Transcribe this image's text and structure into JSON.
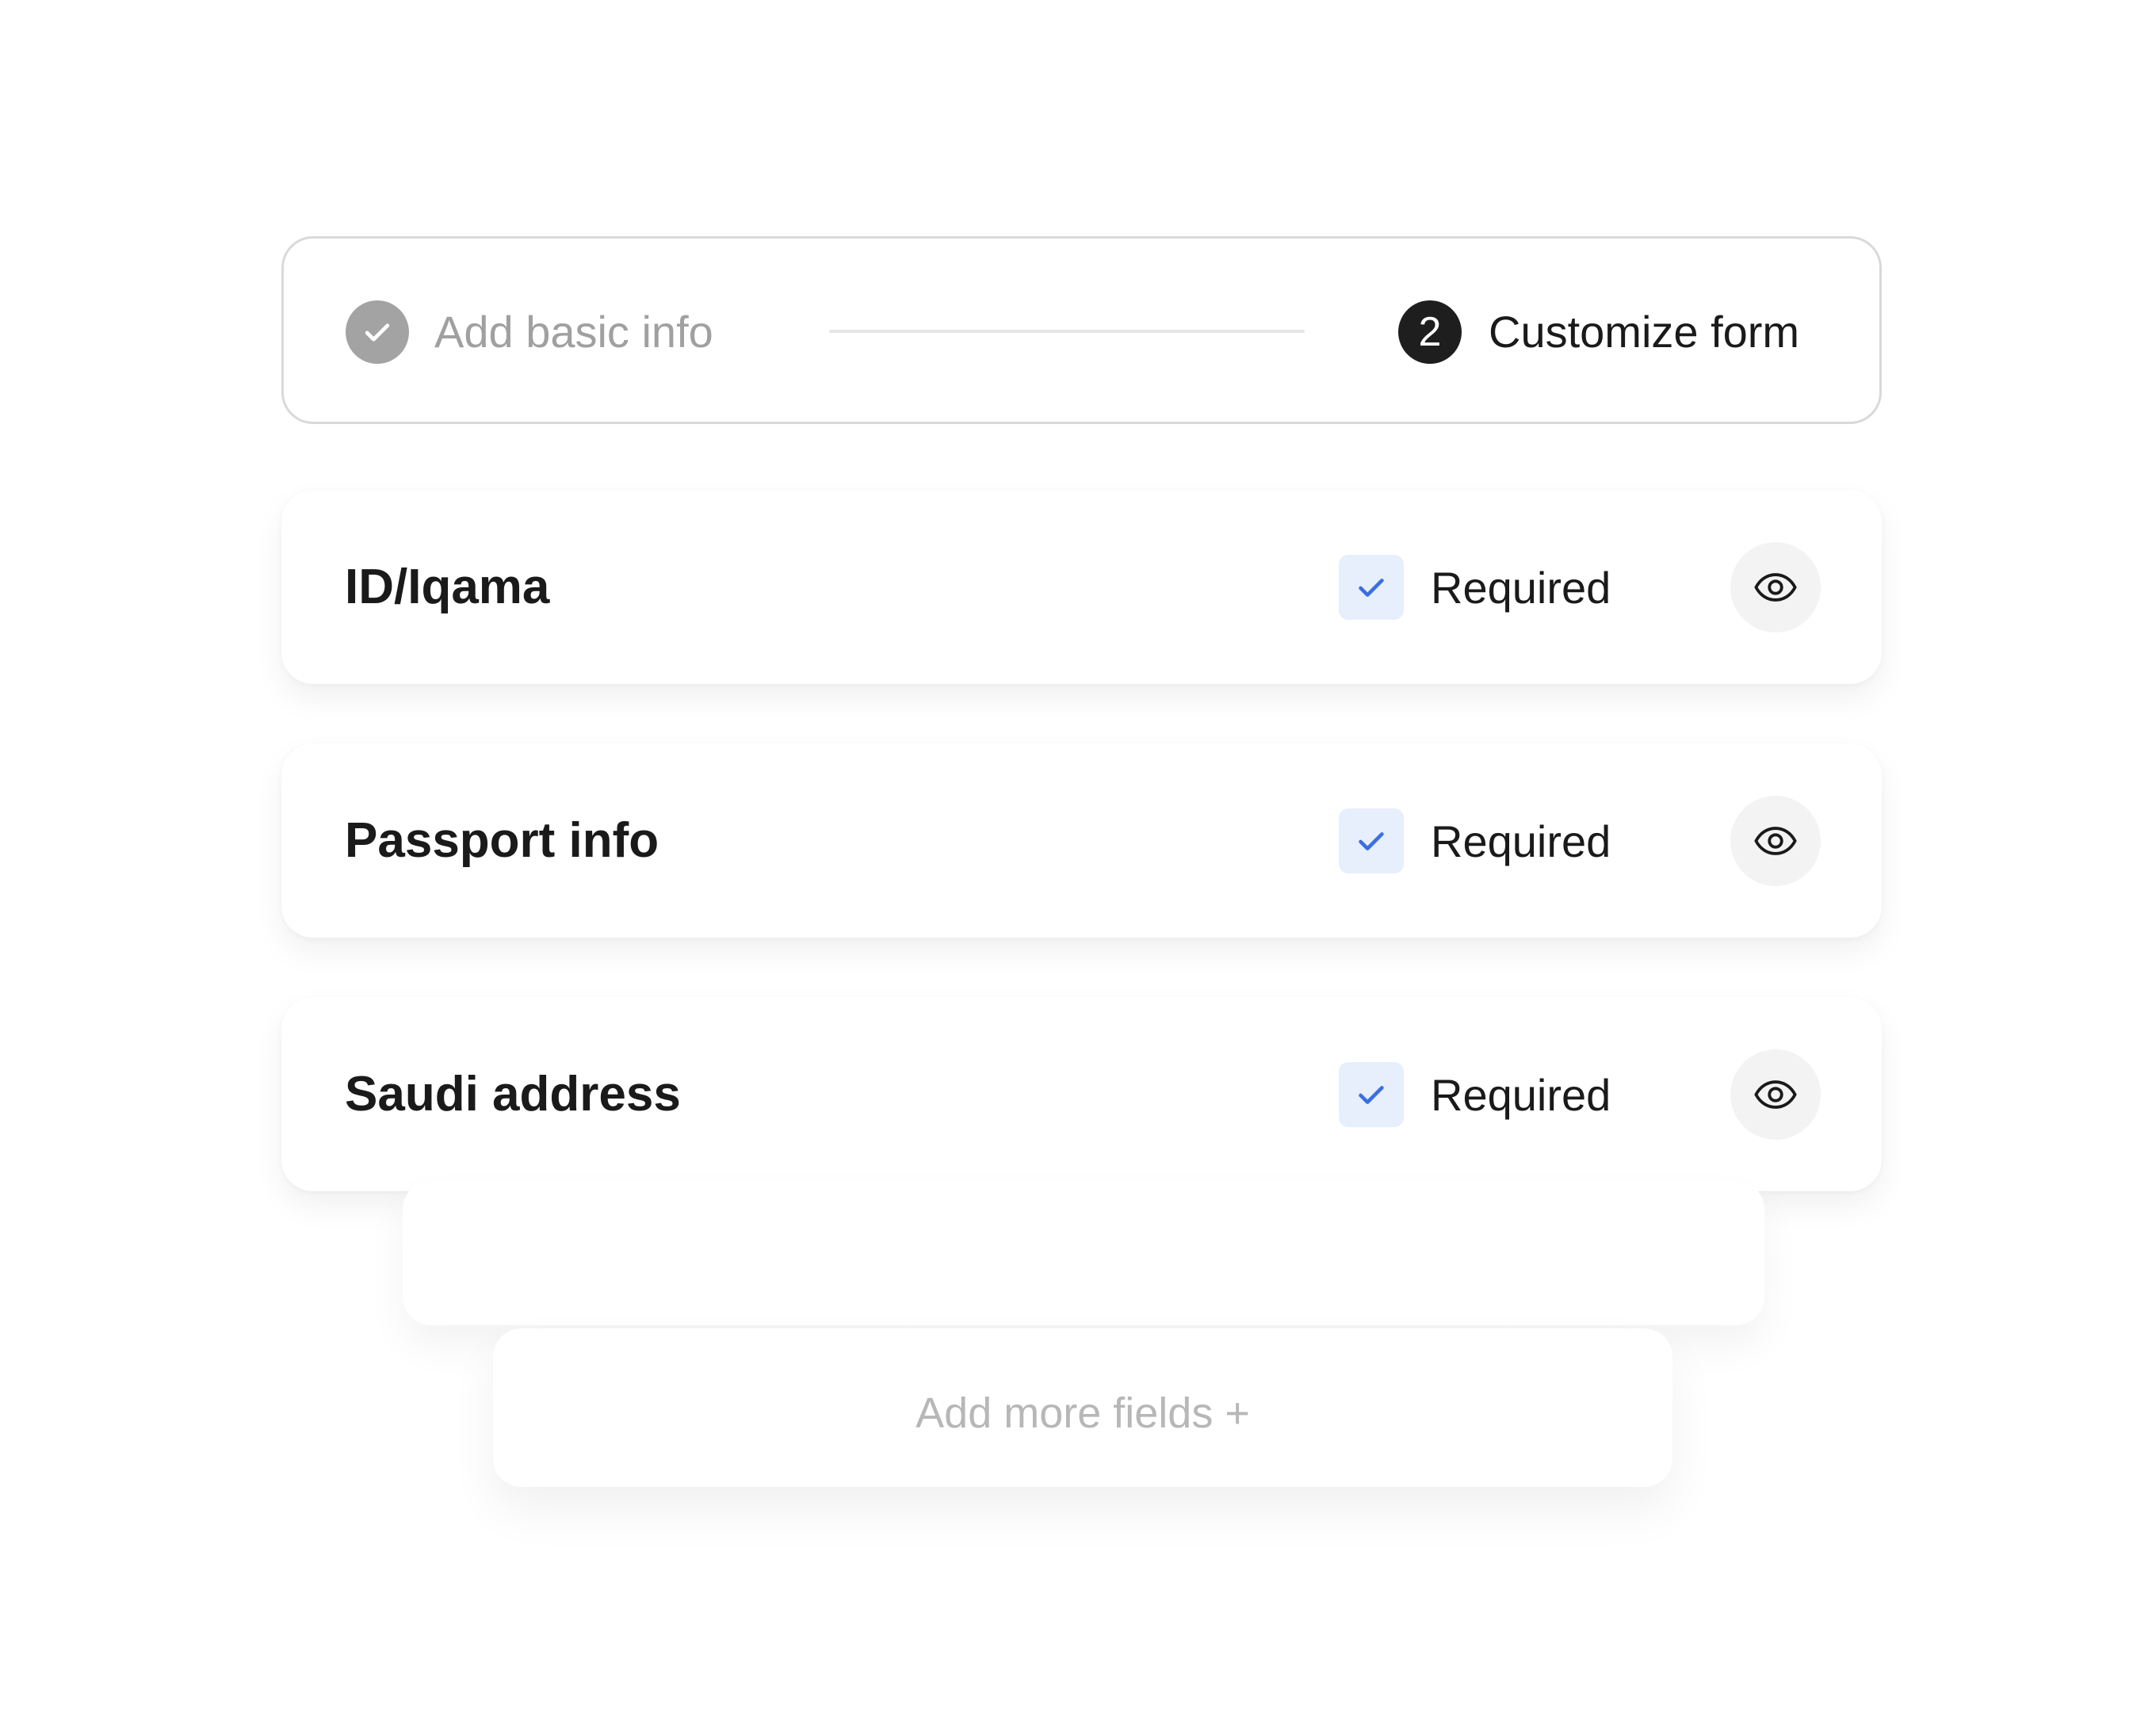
{
  "stepper": {
    "steps": [
      {
        "label": "Add basic info",
        "state": "completed"
      },
      {
        "number": "2",
        "label": "Customize form",
        "state": "active"
      }
    ]
  },
  "fields": [
    {
      "title": "ID/Iqama",
      "required_label": "Required",
      "required": true,
      "visibility_icon": "eye-icon"
    },
    {
      "title": "Passport info",
      "required_label": "Required",
      "required": true,
      "visibility_icon": "eye-icon"
    },
    {
      "title": "Saudi address",
      "required_label": "Required",
      "required": true,
      "visibility_icon": "eye-icon"
    }
  ],
  "add_more": {
    "label": "Add more fields +"
  },
  "colors": {
    "completed_step": "#a3a3a3",
    "active_step": "#1e1e1e",
    "checkbox_bg": "#e7eefc",
    "checkmark": "#3b6fe0",
    "muted_text": "#b7b7b7"
  }
}
